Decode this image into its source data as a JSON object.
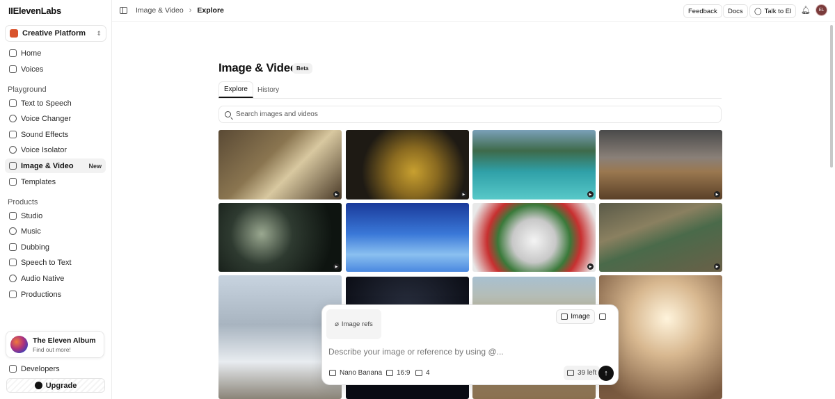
{
  "app": {
    "logo": "IIElevenLabs"
  },
  "workspace": {
    "label": "Creative Platform"
  },
  "sidebar": {
    "top_items": [
      {
        "label": "Home",
        "icon": "home-icon"
      },
      {
        "label": "Voices",
        "icon": "voices-icon"
      }
    ],
    "playground_label": "Playground",
    "playground_items": [
      {
        "label": "Text to Speech",
        "icon": "text-to-speech-icon"
      },
      {
        "label": "Voice Changer",
        "icon": "voice-changer-icon"
      },
      {
        "label": "Sound Effects",
        "icon": "sound-effects-icon"
      },
      {
        "label": "Voice Isolator",
        "icon": "voice-isolator-icon"
      },
      {
        "label": "Image & Video",
        "icon": "image-video-icon",
        "badge": "New",
        "active": true
      },
      {
        "label": "Templates",
        "icon": "templates-icon"
      }
    ],
    "products_label": "Products",
    "product_items": [
      {
        "label": "Studio",
        "icon": "studio-icon"
      },
      {
        "label": "Music",
        "icon": "music-icon"
      },
      {
        "label": "Dubbing",
        "icon": "dubbing-icon"
      },
      {
        "label": "Speech to Text",
        "icon": "speech-to-text-icon"
      },
      {
        "label": "Audio Native",
        "icon": "audio-native-icon"
      },
      {
        "label": "Productions",
        "icon": "productions-icon"
      }
    ],
    "album": {
      "title": "The Eleven Album",
      "subtitle": "Find out more!"
    },
    "developers": "Developers",
    "upgrade": "Upgrade"
  },
  "topbar": {
    "breadcrumb": [
      "Image & Video",
      "Explore"
    ],
    "feedback": "Feedback",
    "docs": "Docs",
    "talk": "Talk to El",
    "avatar": "EL"
  },
  "main": {
    "title": "Image & Video",
    "badge": "Beta",
    "tabs": [
      "Explore",
      "History"
    ],
    "search_placeholder": "Search images and videos"
  },
  "gallery": [
    {
      "name": "book-magnifier",
      "video": true
    },
    {
      "name": "pineapple-knife",
      "video": true
    },
    {
      "name": "tropical-islands",
      "video": true
    },
    {
      "name": "pyramid-army",
      "video": true
    },
    {
      "name": "night-forest-drone",
      "video": true
    },
    {
      "name": "cloud-sky",
      "video": false
    },
    {
      "name": "mexican-sneakers",
      "video": true
    },
    {
      "name": "river-valley",
      "video": true
    },
    {
      "name": "winter-window",
      "video": false
    },
    {
      "name": "space-cockpit",
      "video": false
    },
    {
      "name": "savanna-explorer",
      "video": false
    },
    {
      "name": "sunlit-window",
      "video": false
    }
  ],
  "composer": {
    "image_refs": "Image refs",
    "mode_image": "Image",
    "prompt_placeholder": "Describe your image or reference by using @...",
    "model": "Nano Banana",
    "aspect": "16:9",
    "count": "4",
    "credits": "39 left"
  }
}
